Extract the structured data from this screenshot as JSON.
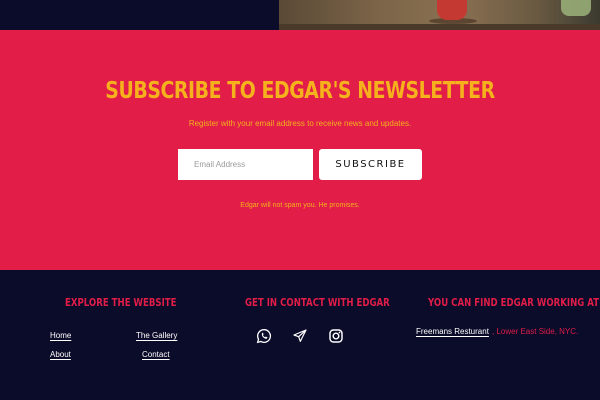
{
  "newsletter": {
    "title": "SUBSCRIBE TO EDGAR'S NEWSLETTER",
    "subtitle": "Register with your email address to receive news and updates.",
    "email_placeholder": "Email Address",
    "subscribe_label": "SUBSCRIBE",
    "note": "Edgar will not spam you. He promises."
  },
  "footer": {
    "explore": {
      "heading": "EXPLORE THE WEBSITE",
      "links": [
        "Home",
        "The Gallery",
        "About",
        "Contact"
      ]
    },
    "contact": {
      "heading": "GET IN CONTACT WITH EDGAR",
      "icons": [
        "whatsapp-icon",
        "send-icon",
        "instagram-icon"
      ]
    },
    "location": {
      "heading": "YOU CAN FIND EDGAR WORKING AT",
      "place": "Freemans Resturant",
      "area": ", Lower East Side, NYC."
    }
  },
  "colors": {
    "brand_red": "#e11d48",
    "accent_yellow": "#f5b21c",
    "navy": "#0b0b2a"
  }
}
